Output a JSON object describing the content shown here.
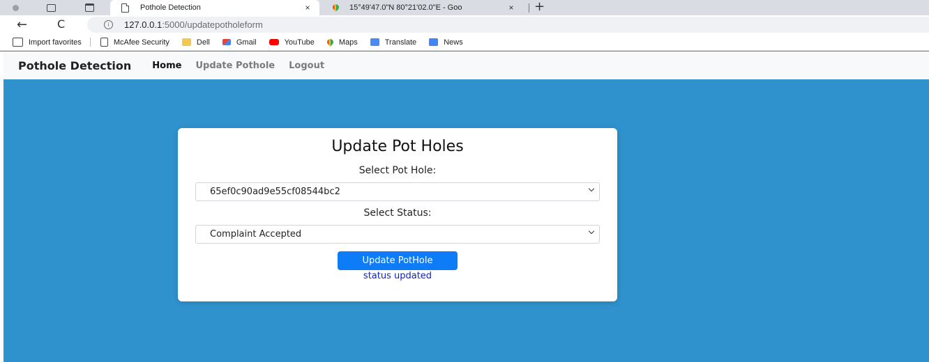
{
  "browser": {
    "tabs": [
      {
        "title": "Pothole Detection",
        "close": "×",
        "active": true
      },
      {
        "title": "15°49'47.0\"N 80°21'02.0\"E - Goo",
        "close": "×",
        "active": false
      }
    ],
    "new_tab": "+",
    "back": "←",
    "reload": "C",
    "url_host": "127.0.0.1",
    "url_path": ":5000/updatepotholeform",
    "bookmarks": [
      {
        "label": "Import favorites",
        "icon": "import-icon"
      },
      {
        "label": "McAfee Security",
        "icon": "page-icon"
      },
      {
        "label": "Dell",
        "icon": "folder-icon"
      },
      {
        "label": "Gmail",
        "icon": "gmail-icon"
      },
      {
        "label": "YouTube",
        "icon": "youtube-icon"
      },
      {
        "label": "Maps",
        "icon": "maps-icon"
      },
      {
        "label": "Translate",
        "icon": "translate-icon"
      },
      {
        "label": "News",
        "icon": "news-icon"
      }
    ]
  },
  "navbar": {
    "brand": "Pothole Detection",
    "links": [
      "Home",
      "Update Pothole",
      "Logout"
    ]
  },
  "form": {
    "title": "Update Pot Holes",
    "pothole_label": "Select Pot Hole:",
    "pothole_value": "65ef0c90ad9e55cf08544bc2",
    "status_label": "Select Status:",
    "status_value": "Complaint Accepted",
    "submit_label": "Update PotHole",
    "message": "status updated"
  },
  "colors": {
    "page_background": "#2f92cd",
    "button": "#0d7cf6",
    "message": "#0a1fd6"
  }
}
